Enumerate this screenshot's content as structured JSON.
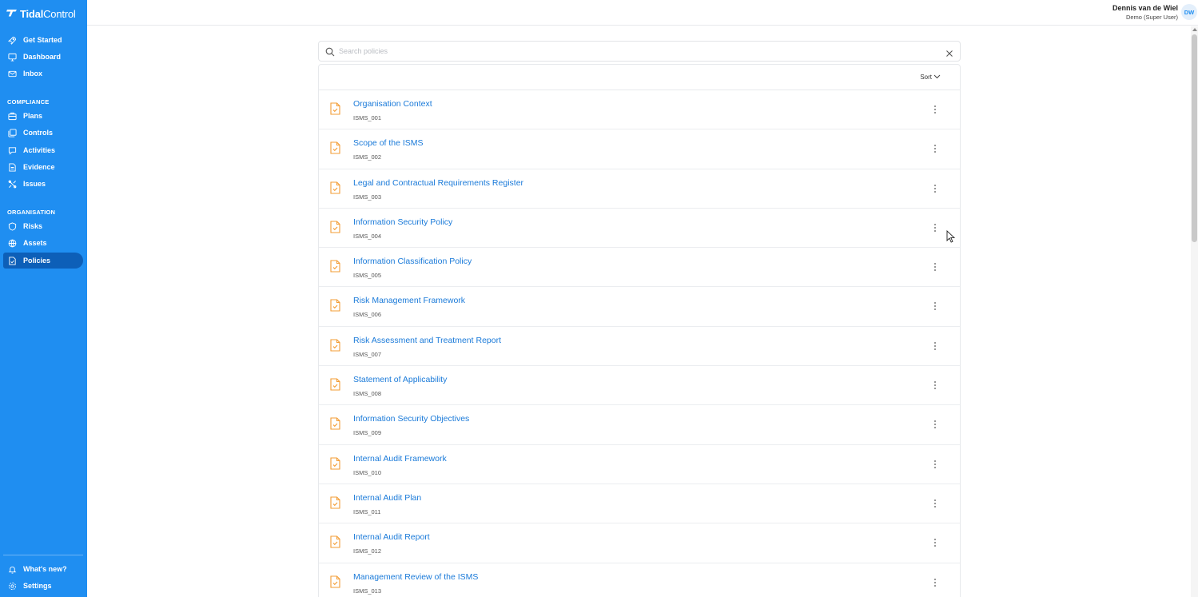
{
  "brand": {
    "name_bold": "Tidal",
    "name_light": "Control"
  },
  "sidebar": {
    "top_items": [
      {
        "label": "Get Started",
        "icon": "rocket-icon"
      },
      {
        "label": "Dashboard",
        "icon": "monitor-icon"
      },
      {
        "label": "Inbox",
        "icon": "mail-icon"
      }
    ],
    "compliance_label": "COMPLIANCE",
    "compliance_items": [
      {
        "label": "Plans",
        "icon": "briefcase-icon"
      },
      {
        "label": "Controls",
        "icon": "controls-icon"
      },
      {
        "label": "Activities",
        "icon": "chat-icon"
      },
      {
        "label": "Evidence",
        "icon": "file-icon"
      },
      {
        "label": "Issues",
        "icon": "tools-icon"
      }
    ],
    "organisation_label": "ORGANISATION",
    "organisation_items": [
      {
        "label": "Risks",
        "icon": "shield-icon"
      },
      {
        "label": "Assets",
        "icon": "globe-icon"
      },
      {
        "label": "Policies",
        "icon": "policy-icon",
        "active": true
      }
    ],
    "bottom_items": [
      {
        "label": "What's new?",
        "icon": "bell-icon"
      },
      {
        "label": "Settings",
        "icon": "gear-icon"
      }
    ]
  },
  "user": {
    "name": "Dennis van de Wiel",
    "role": "Demo (Super User)",
    "initials": "DW"
  },
  "search": {
    "placeholder": "Search policies",
    "value": ""
  },
  "list": {
    "sort_label": "Sort",
    "policies": [
      {
        "title": "Organisation Context",
        "code": "ISMS_001"
      },
      {
        "title": "Scope of the ISMS",
        "code": "ISMS_002"
      },
      {
        "title": "Legal and Contractual Requirements Register",
        "code": "ISMS_003"
      },
      {
        "title": "Information Security Policy",
        "code": "ISMS_004"
      },
      {
        "title": "Information Classification Policy",
        "code": "ISMS_005"
      },
      {
        "title": "Risk Management Framework",
        "code": "ISMS_006"
      },
      {
        "title": "Risk Assessment and Treatment Report",
        "code": "ISMS_007"
      },
      {
        "title": "Statement of Applicability",
        "code": "ISMS_008"
      },
      {
        "title": "Information Security Objectives",
        "code": "ISMS_009"
      },
      {
        "title": "Internal Audit Framework",
        "code": "ISMS_010"
      },
      {
        "title": "Internal Audit Plan",
        "code": "ISMS_011"
      },
      {
        "title": "Internal Audit Report",
        "code": "ISMS_012"
      },
      {
        "title": "Management Review of the ISMS",
        "code": "ISMS_013"
      }
    ]
  },
  "colors": {
    "sidebar": "#1f8ef1",
    "active_nav": "#0d5fb8",
    "link": "#1a7ad9",
    "doc_icon": "#f39c34"
  }
}
